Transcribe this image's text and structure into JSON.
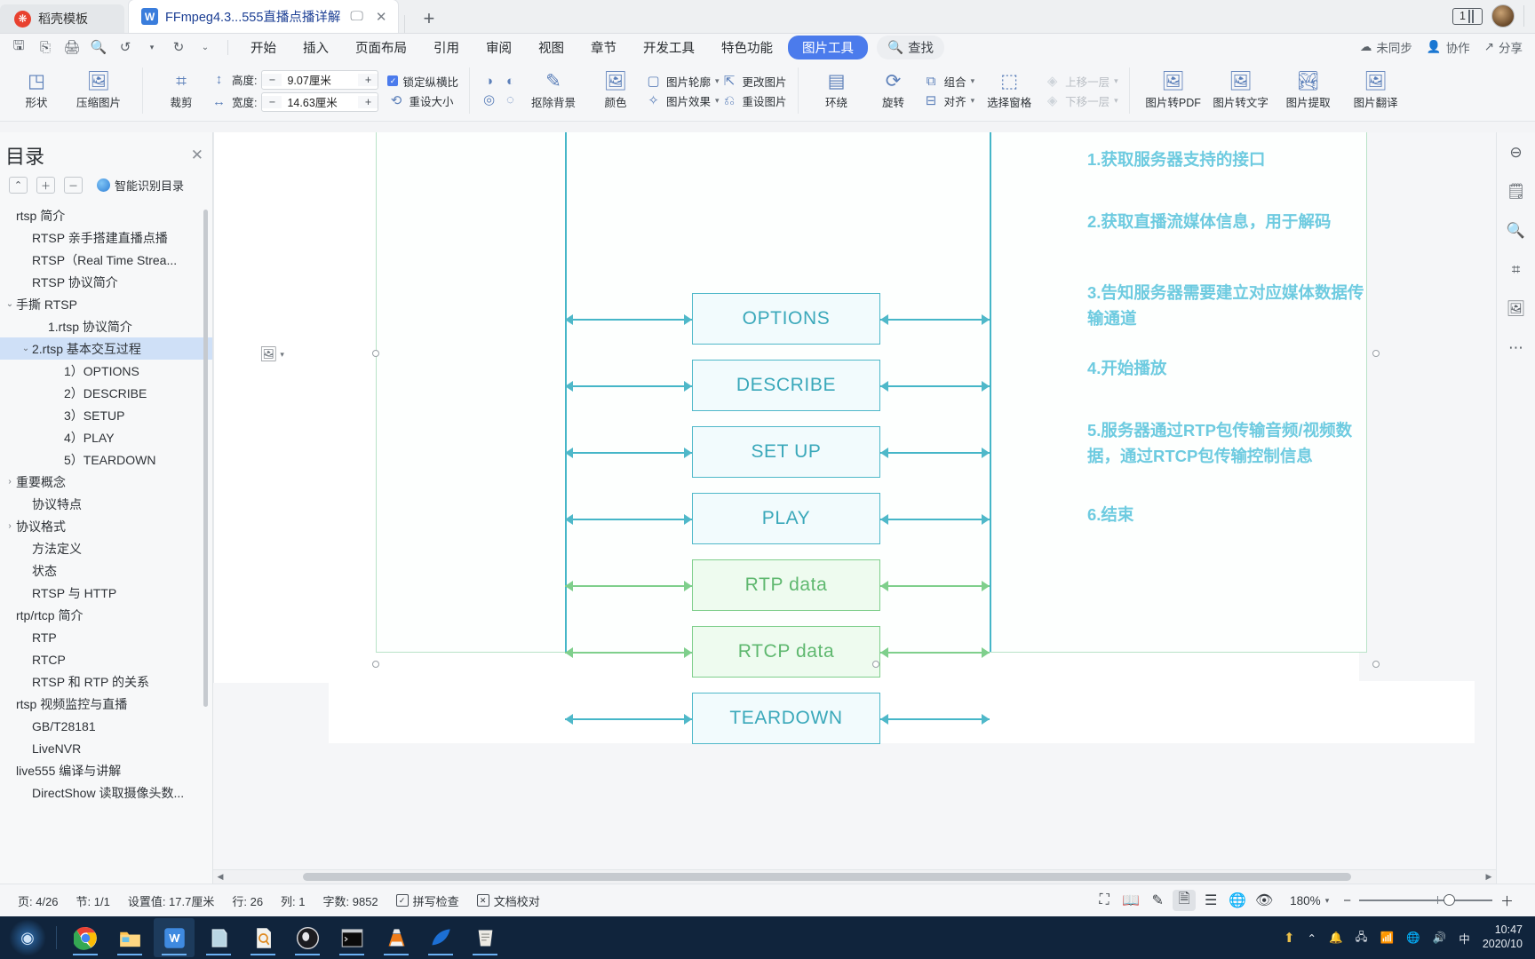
{
  "tabbar": {
    "template_tab": "稻壳模板",
    "doc_tab": "FFmpeg4.3...555直播点播详解",
    "newtab_label": "+",
    "page_badge": "1"
  },
  "quickaccess": {
    "icons": [
      "save-icon",
      "save-as-icon",
      "print-icon",
      "print-preview-icon",
      "undo-icon",
      "redo-icon",
      "customize-icon"
    ]
  },
  "menu": {
    "items": [
      "开始",
      "插入",
      "页面布局",
      "引用",
      "审阅",
      "视图",
      "章节",
      "开发工具",
      "特色功能"
    ],
    "active_pill": "图片工具",
    "find": "查找"
  },
  "header_right": {
    "sync": "未同步",
    "collab": "协作",
    "share": "分享"
  },
  "ribbon": {
    "shape": "形状",
    "compress": "压缩图片",
    "crop": "裁剪",
    "height_label": "高度:",
    "height_value": "9.07厘米",
    "width_label": "宽度:",
    "width_value": "14.63厘米",
    "lock_aspect": "锁定纵横比",
    "reset_size": "重设大小",
    "remove_bg": "抠除背景",
    "color": "颜色",
    "picture_outline": "图片轮廓",
    "picture_effect": "图片效果",
    "change_picture": "更改图片",
    "reset_picture": "重设图片",
    "wrap": "环绕",
    "rotate": "旋转",
    "group": "组合",
    "align": "对齐",
    "select_pane": "选择窗格",
    "bring_forward": "上移一层",
    "send_backward": "下移一层",
    "to_pdf": "图片转PDF",
    "to_text": "图片转文字",
    "extract": "图片提取",
    "translate": "图片翻译",
    "minus": "−",
    "plus": "+"
  },
  "sidebar": {
    "title": "目录",
    "smart_toc": "智能识别目录",
    "tools": [
      "collapse-all-icon",
      "expand-icon",
      "collapse-icon"
    ],
    "items": [
      {
        "label": "rtsp 简介",
        "indent": 0,
        "caret": "",
        "selected": false
      },
      {
        "label": "RTSP 亲手搭建直播点播",
        "indent": 1,
        "caret": "",
        "selected": false
      },
      {
        "label": "RTSP（Real Time Strea...",
        "indent": 1,
        "caret": "",
        "selected": false
      },
      {
        "label": "RTSP 协议简介",
        "indent": 1,
        "caret": "",
        "selected": false
      },
      {
        "label": "手撕 RTSP",
        "indent": 0,
        "caret": "⌄",
        "selected": false
      },
      {
        "label": "1.rtsp 协议简介",
        "indent": 2,
        "caret": "",
        "selected": false
      },
      {
        "label": "2.rtsp 基本交互过程",
        "indent": 1,
        "caret": "⌄",
        "selected": true
      },
      {
        "label": "1）OPTIONS",
        "indent": 3,
        "caret": "",
        "selected": false
      },
      {
        "label": "2）DESCRIBE",
        "indent": 3,
        "caret": "",
        "selected": false
      },
      {
        "label": "3）SETUP",
        "indent": 3,
        "caret": "",
        "selected": false
      },
      {
        "label": "4）PLAY",
        "indent": 3,
        "caret": "",
        "selected": false
      },
      {
        "label": "5）TEARDOWN",
        "indent": 3,
        "caret": "",
        "selected": false
      },
      {
        "label": "重要概念",
        "indent": 0,
        "caret": "›",
        "selected": false
      },
      {
        "label": "协议特点",
        "indent": 1,
        "caret": "",
        "selected": false
      },
      {
        "label": "协议格式",
        "indent": 0,
        "caret": "›",
        "selected": false
      },
      {
        "label": "方法定义",
        "indent": 1,
        "caret": "",
        "selected": false
      },
      {
        "label": "状态",
        "indent": 1,
        "caret": "",
        "selected": false
      },
      {
        "label": "RTSP 与 HTTP",
        "indent": 1,
        "caret": "",
        "selected": false
      },
      {
        "label": "rtp/rtcp 简介",
        "indent": 0,
        "caret": "",
        "selected": false
      },
      {
        "label": "RTP",
        "indent": 1,
        "caret": "",
        "selected": false
      },
      {
        "label": "RTCP",
        "indent": 1,
        "caret": "",
        "selected": false
      },
      {
        "label": "RTSP 和 RTP 的关系",
        "indent": 1,
        "caret": "",
        "selected": false
      },
      {
        "label": "rtsp 视频监控与直播",
        "indent": 0,
        "caret": "",
        "selected": false
      },
      {
        "label": "GB/T28181",
        "indent": 1,
        "caret": "",
        "selected": false
      },
      {
        "label": "LiveNVR",
        "indent": 1,
        "caret": "",
        "selected": false
      },
      {
        "label": "live555 编译与讲解",
        "indent": 0,
        "caret": "",
        "selected": false
      },
      {
        "label": "DirectShow 读取摄像头数...",
        "indent": 1,
        "caret": "",
        "selected": false
      }
    ]
  },
  "diagram": {
    "messages": [
      {
        "label": "OPTIONS",
        "color": "blue"
      },
      {
        "label": "DESCRIBE",
        "color": "blue"
      },
      {
        "label": "SET UP",
        "color": "blue"
      },
      {
        "label": "PLAY",
        "color": "blue"
      },
      {
        "label": "RTP data",
        "color": "green"
      },
      {
        "label": "RTCP data",
        "color": "green"
      },
      {
        "label": "TEARDOWN",
        "color": "blue"
      }
    ],
    "notes": [
      "1.获取服务器支持的接口",
      "2.获取直播流媒体信息，用于解码",
      "3.告知服务器需要建立对应媒体数据传输通道",
      "4.开始播放",
      "5.服务器通过RTP包传输音频/视频数据，通过RTCP包传输控制信息",
      "6.结束"
    ],
    "colors": {
      "blue": "#4fb8c9",
      "green": "#7fcf8c",
      "note": "#6ecbe0"
    }
  },
  "status": {
    "page": "页: 4/26",
    "section": "节: 1/1",
    "setting": "设置值: 17.7厘米",
    "line": "行: 26",
    "column": "列: 1",
    "words": "字数: 9852",
    "spellcheck": "拼写检查",
    "proofread": "文档校对",
    "zoom": "180%",
    "views": [
      "fullscreen-icon",
      "reading-layout-icon",
      "edit-layout-icon",
      "page-layout-icon",
      "outline-icon",
      "web-layout-icon",
      "eye-protection-icon"
    ]
  },
  "taskbar": {
    "apps": [
      "chrome-icon",
      "file-explorer-icon",
      "wps-writer-icon",
      "notes-icon",
      "pdf-icon",
      "obs-icon",
      "terminal-icon",
      "vlc-icon",
      "wireshark-icon",
      "sublime-icon"
    ],
    "tray": [
      "upload-icon",
      "chevron-up-icon",
      "notification-icon",
      "network-icon",
      "wifi-icon",
      "volume-icon",
      "ime-icon"
    ],
    "ime": "中",
    "time": "10:47",
    "date": "2020/10"
  }
}
